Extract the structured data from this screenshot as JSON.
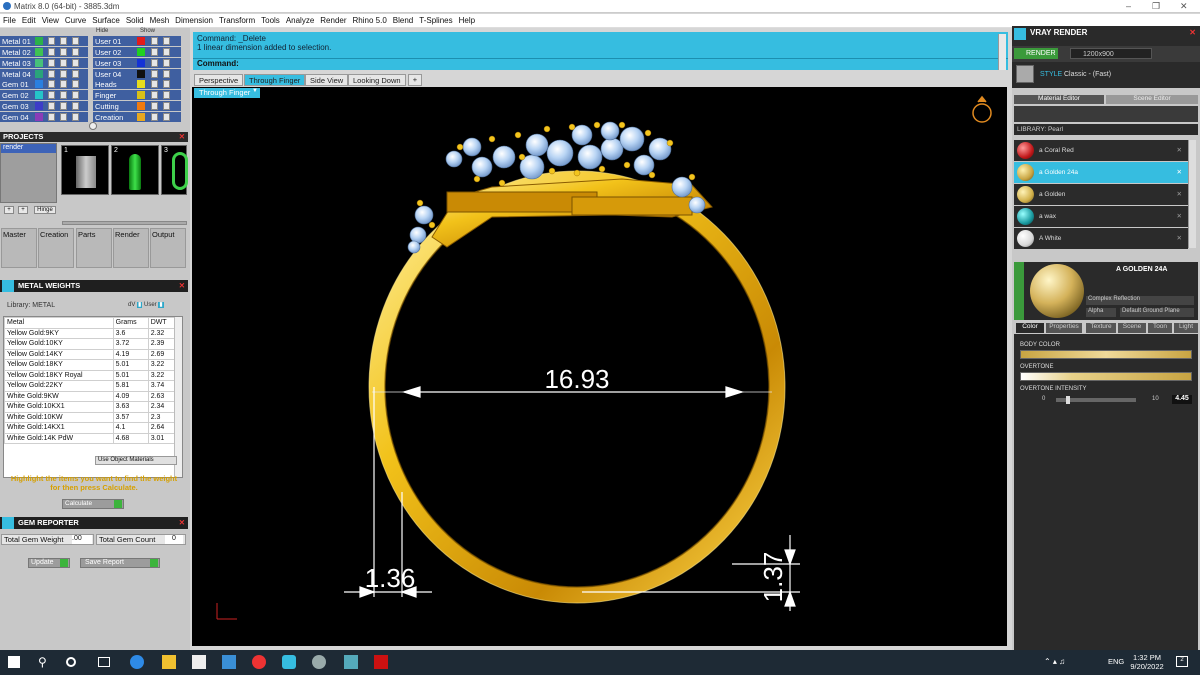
{
  "window": {
    "title": "Matrix 8.0 (64-bit) - 3885.3dm"
  },
  "menu": [
    "File",
    "Edit",
    "View",
    "Curve",
    "Surface",
    "Solid",
    "Mesh",
    "Dimension",
    "Transform",
    "Tools",
    "Analyze",
    "Render",
    "Rhino 5.0",
    "Blend",
    "T-Splines",
    "Help"
  ],
  "layers": {
    "top_buttons": [
      "Hide",
      "Show"
    ],
    "metals": [
      {
        "name": "Metal 01",
        "color": "#2bb14a"
      },
      {
        "name": "Metal 02",
        "color": "#3fc253"
      },
      {
        "name": "Metal 03",
        "color": "#47c07a"
      },
      {
        "name": "Metal 04",
        "color": "#2aa37a"
      }
    ],
    "users": [
      {
        "name": "User 01",
        "color": "#e31b1b"
      },
      {
        "name": "User 02",
        "color": "#20d020"
      },
      {
        "name": "User 03",
        "color": "#1432d6"
      },
      {
        "name": "User 04",
        "color": "#101010"
      }
    ],
    "gems": [
      {
        "name": "Gem 01",
        "color": "#2a7fe0"
      },
      {
        "name": "Gem 02",
        "color": "#25c4c8"
      },
      {
        "name": "Gem 03",
        "color": "#3c3cc8"
      },
      {
        "name": "Gem 04",
        "color": "#8b3cb8"
      }
    ],
    "others": [
      {
        "name": "Heads",
        "color": "#e6dc1e"
      },
      {
        "name": "Finger",
        "color": "#d8c018"
      },
      {
        "name": "Cutting",
        "color": "#f07a10"
      },
      {
        "name": "Creation",
        "color": "#e8a820"
      }
    ]
  },
  "projects": {
    "title": "PROJECTS",
    "list_item": "render",
    "thumbs": [
      "1",
      "2",
      "3"
    ],
    "hinge_label": "Hinge",
    "categories": [
      "Master",
      "Creation",
      "Parts",
      "Render",
      "Output"
    ]
  },
  "metal_weights": {
    "title": "METAL WEIGHTS",
    "library_label": "Library: METAL",
    "headers": [
      "Metal",
      "Grams",
      "DWT"
    ],
    "rows": [
      [
        "Yellow Gold:9KY",
        "3.6",
        "2.32"
      ],
      [
        "Yellow Gold:10KY",
        "3.72",
        "2.39"
      ],
      [
        "Yellow Gold:14KY",
        "4.19",
        "2.69"
      ],
      [
        "Yellow Gold:18KY",
        "5.01",
        "3.22"
      ],
      [
        "Yellow Gold:18KY Royal",
        "5.01",
        "3.22"
      ],
      [
        "Yellow Gold:22KY",
        "5.81",
        "3.74"
      ],
      [
        "White Gold:9KW",
        "4.09",
        "2.63"
      ],
      [
        "White Gold:10KX1",
        "3.63",
        "2.34"
      ],
      [
        "White Gold:10KW",
        "3.57",
        "2.3"
      ],
      [
        "White Gold:14KX1",
        "4.1",
        "2.64"
      ],
      [
        "White Gold:14K PdW",
        "4.68",
        "3.01"
      ]
    ],
    "use_object_materials": "Use Object Materials",
    "hint": "Highlight the items you want to find the weight for then press Calculate.",
    "calculate": "Calculate"
  },
  "gem_reporter": {
    "title": "GEM REPORTER",
    "total_weight_label": "Total Gem Weight",
    "total_weight": ".00",
    "total_count_label": "Total Gem Count",
    "total_count": "0",
    "update": "Update",
    "save_report": "Save Report"
  },
  "command": {
    "line1": "Command: _Delete",
    "line2": "1 linear dimension added to selection.",
    "prompt": "Command:"
  },
  "viewport_tabs": [
    "Perspective",
    "Through Finger",
    "Side View",
    "Looking Down"
  ],
  "viewport_label": "Through Finger",
  "dimensions": {
    "width": "16.93",
    "thickness": "1.36",
    "height": "1.37"
  },
  "vray": {
    "title": "VRAY RENDER",
    "render_button": "RENDER",
    "resolution": "1200x900",
    "style_label": "STYLE",
    "style_value": "Classic - (Fast)",
    "tabs": [
      "Material Editor",
      "Scene Editor"
    ],
    "library_label": "LIBRARY: Pearl",
    "materials": [
      {
        "name": "a Coral Red",
        "color": "#c2191b"
      },
      {
        "name": "a Golden 24a",
        "color": "#c8a442"
      },
      {
        "name": "a Golden",
        "color": "#d1b04a"
      },
      {
        "name": "a wax",
        "color": "#1a9aa0"
      },
      {
        "name": "A White",
        "color": "#d9d9d9"
      }
    ],
    "selected_material": "A GOLDEN 24A",
    "reflection": "Complex Reflection",
    "alpha_label": "Alpha",
    "ground_plane": "Default Ground Plane",
    "prop_tabs": [
      "Color",
      "Properties",
      "Texture",
      "Scene",
      "Toon",
      "Light"
    ],
    "body_color_label": "BODY COLOR",
    "overtone_label": "OVERTONE",
    "overtone_intensity_label": "OVERTONE INTENSITY",
    "intensity_min": "0",
    "intensity_max": "10",
    "intensity_value": "4.45"
  },
  "taskbar": {
    "time": "1:32 PM",
    "date": "9/20/2022",
    "lang": "ENG"
  }
}
